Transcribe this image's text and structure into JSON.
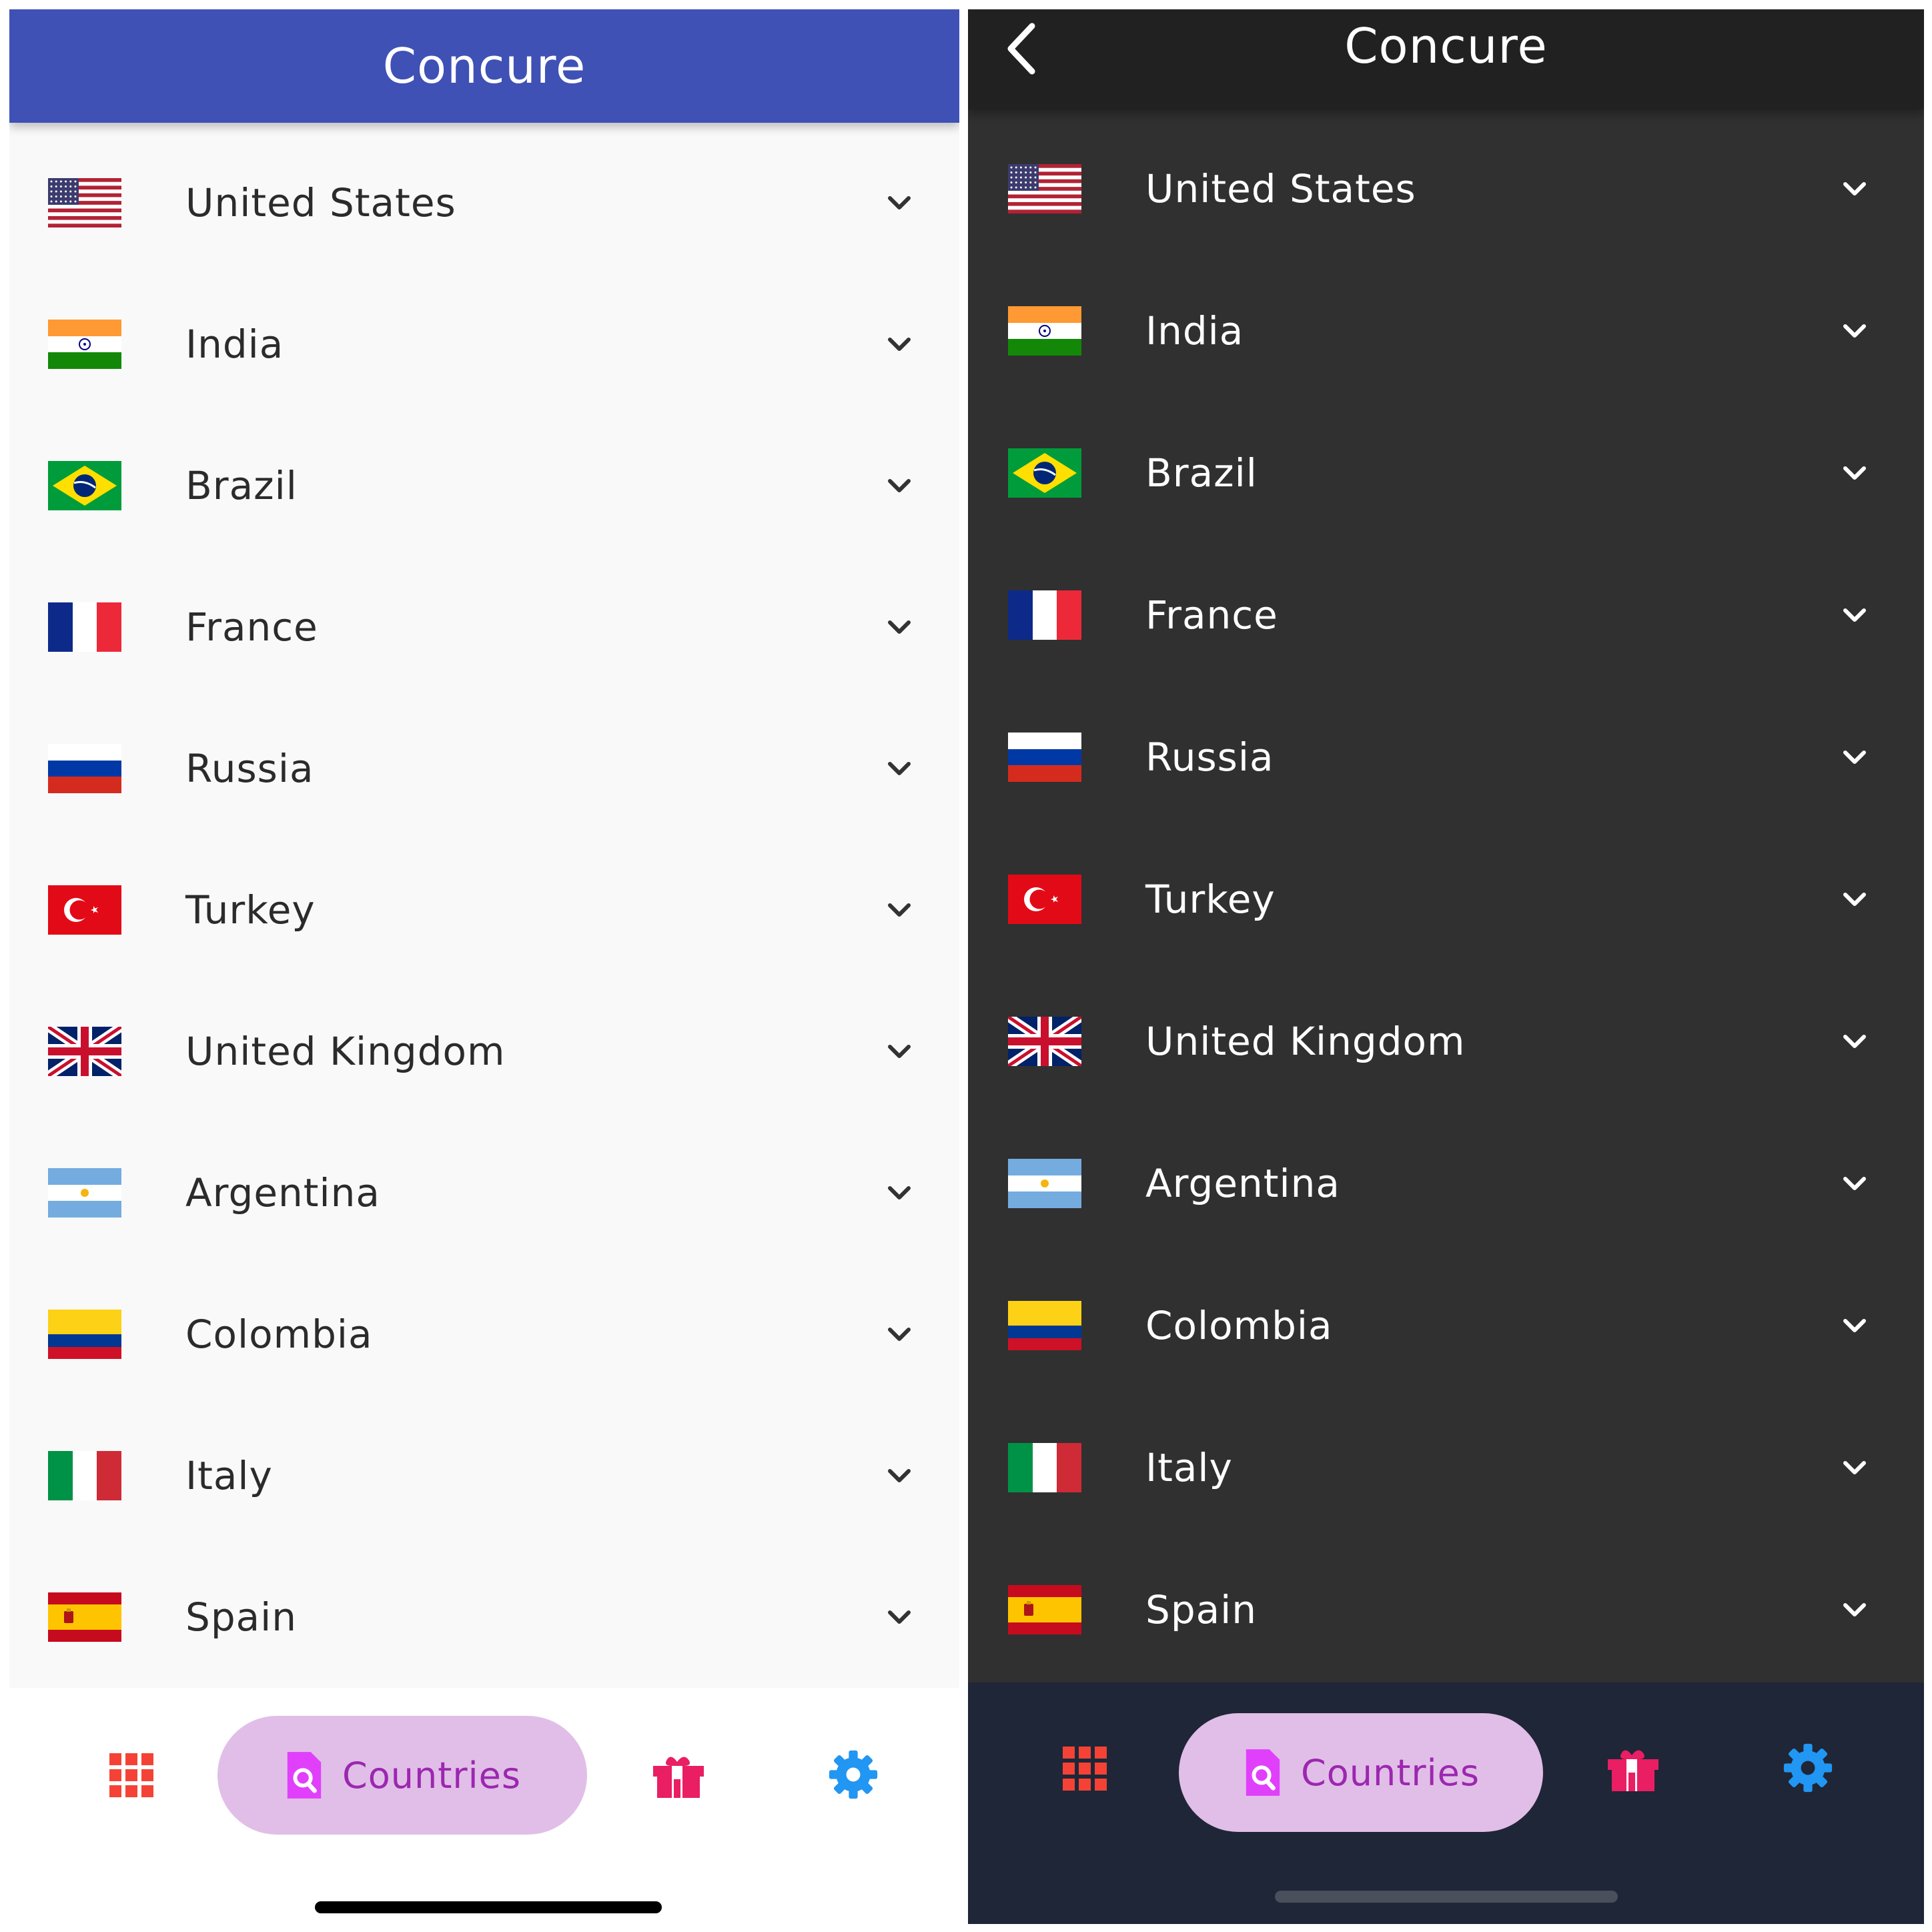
{
  "app": {
    "title": "Concure"
  },
  "countries": [
    {
      "name": "United States",
      "flag": "us-flag-icon"
    },
    {
      "name": "India",
      "flag": "india-flag-icon"
    },
    {
      "name": "Brazil",
      "flag": "brazil-flag-icon"
    },
    {
      "name": "France",
      "flag": "france-flag-icon"
    },
    {
      "name": "Russia",
      "flag": "russia-flag-icon"
    },
    {
      "name": "Turkey",
      "flag": "turkey-flag-icon"
    },
    {
      "name": "United Kingdom",
      "flag": "uk-flag-icon"
    },
    {
      "name": "Argentina",
      "flag": "argentina-flag-icon"
    },
    {
      "name": "Colombia",
      "flag": "colombia-flag-icon"
    },
    {
      "name": "Italy",
      "flag": "italy-flag-icon"
    },
    {
      "name": "Spain",
      "flag": "spain-flag-icon"
    }
  ],
  "bottom_nav": {
    "items": [
      {
        "icon": "grid-icon",
        "label": ""
      },
      {
        "icon": "search-document-icon",
        "label": "Countries",
        "selected": true
      },
      {
        "icon": "gift-icon",
        "label": ""
      },
      {
        "icon": "gear-icon",
        "label": ""
      }
    ]
  },
  "themes": {
    "light": {
      "appbar": "#3f51b5",
      "background": "#f9f9f9",
      "text": "#2b2b2b"
    },
    "dark": {
      "appbar": "#212121",
      "background": "#303030",
      "text": "#ffffff",
      "nav": "#1f2637"
    },
    "accent_pill": "#e1bee7",
    "accent_text": "#9c27b0",
    "grid_icon": "#f44336",
    "gift_icon": "#e91e63",
    "gear_icon": "#2196f3"
  }
}
